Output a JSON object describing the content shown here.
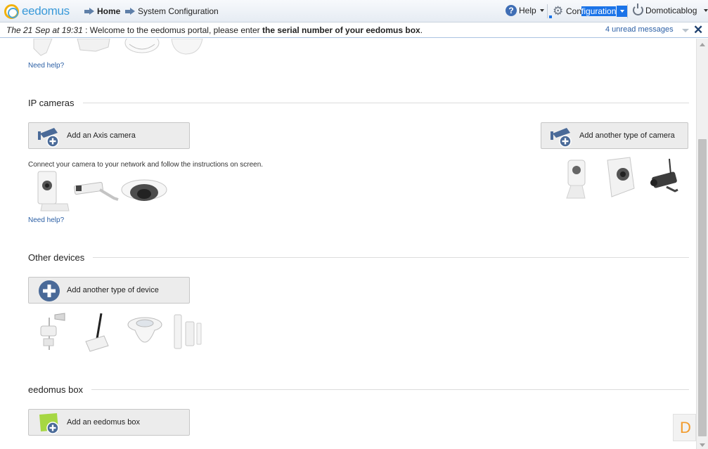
{
  "header": {
    "logo_text": "eedomus",
    "breadcrumb": [
      {
        "label": "Home"
      },
      {
        "label": "System Configuration"
      }
    ],
    "help_label": "Help",
    "configuration_prefix": "Con",
    "configuration_selected": "figuration",
    "user_label": "Domoticablog",
    "icons": [
      "arrow-right-icon",
      "help-icon",
      "gear-icon",
      "power-icon"
    ]
  },
  "message": {
    "date": "The 21 Sep at 19:31",
    "text_prefix": " : Welcome to the eedomus portal, please enter ",
    "text_bold": "the serial number of your eedomus box",
    "text_suffix": ".",
    "unread": "4 unread messages",
    "close_symbol": "✕"
  },
  "help_link": "Need help?",
  "sections": {
    "ip_cameras": {
      "title": "IP cameras",
      "axis_button": "Add an Axis camera",
      "other_button": "Add another type of camera",
      "caption": "Connect your camera to your network and follow the instructions on screen."
    },
    "other_devices": {
      "title": "Other devices",
      "add_button": "Add another type of device"
    },
    "eedomus_box": {
      "title": "eedomus box",
      "add_button": "Add an eedomus box"
    }
  },
  "corner_badge": "D",
  "colors": {
    "accent": "#3f6eb5",
    "link": "#2b5fa5",
    "selection": "#1a73e8",
    "logo_yellow": "#f1b20d",
    "logo_blue": "#3a9ad9",
    "badge_orange": "#f29b2c",
    "box_green": "#a6d743"
  }
}
